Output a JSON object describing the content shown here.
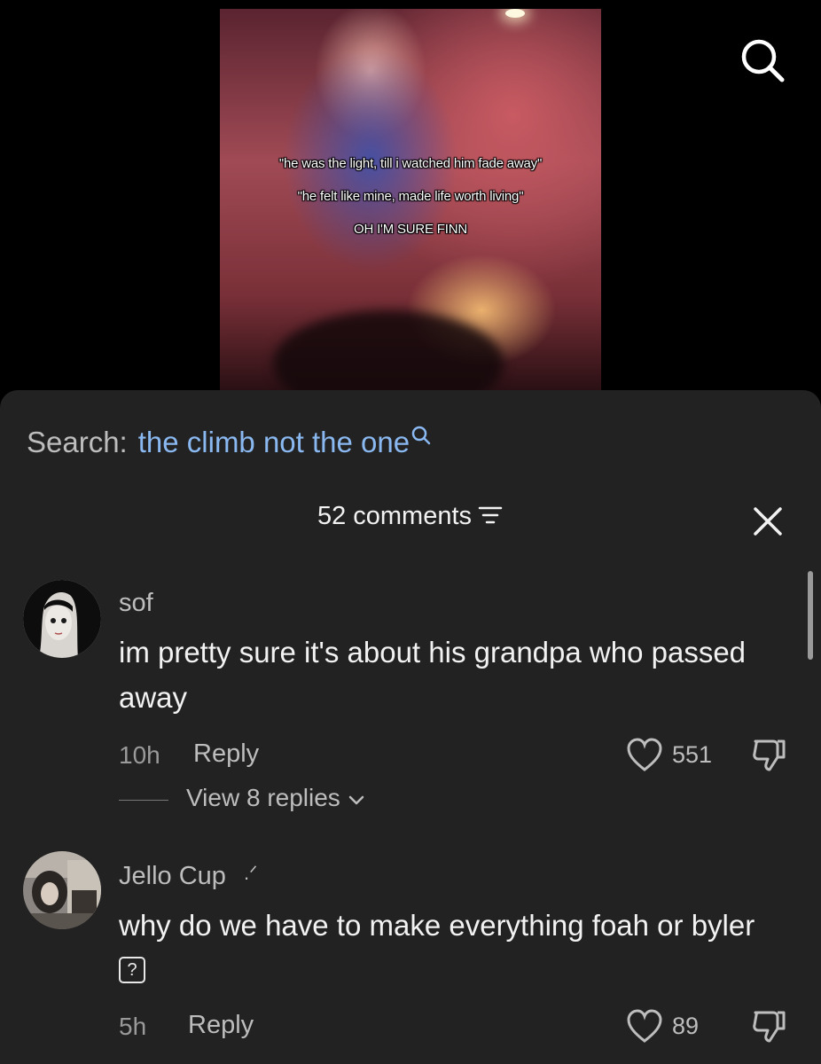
{
  "video": {
    "captions": [
      "\"he was the light, till i watched him fade away\"",
      "\"he felt like mine, made life worth living\"",
      "OH I'M SURE FINN"
    ]
  },
  "search": {
    "label": "Search:",
    "query": "the climb not the one"
  },
  "comments_header": {
    "count_label": "52 comments"
  },
  "comments": [
    {
      "username": "sof",
      "text": "im pretty sure it's about his grandpa who passed away",
      "time": "10h",
      "reply_label": "Reply",
      "likes": "551",
      "view_replies": "View 8 replies"
    },
    {
      "username": "Jello Cup",
      "username_suffix": ".ᐟ",
      "text": "why do we have to make everything foah or byler",
      "text_glyph": "?",
      "time": "5h",
      "reply_label": "Reply",
      "likes": "89"
    }
  ],
  "icons": {
    "search": "search-icon",
    "filter": "filter-icon",
    "close": "close-icon",
    "like": "heart-icon",
    "dislike": "thumbs-down-icon",
    "chevron": "chevron-down-icon"
  },
  "colors": {
    "sheet_bg": "#222222",
    "query_link": "#8ab8f0",
    "muted_text": "#9a9a9a"
  }
}
